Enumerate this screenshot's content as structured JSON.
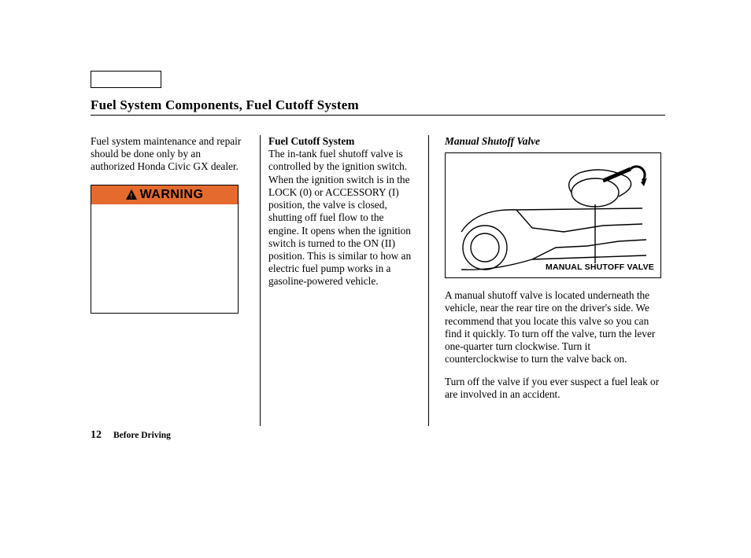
{
  "page": {
    "title": "Fuel System Components, Fuel Cutoff System",
    "number": "12",
    "section": "Before Driving"
  },
  "col1": {
    "p1": "Fuel system maintenance and repair should be done only by an authorized Honda Civic GX dealer.",
    "warning_label": "WARNING"
  },
  "col2": {
    "heading": "Fuel Cutoff System",
    "p1": "The in-tank fuel shutoff valve is controlled by the ignition switch. When the ignition switch is in the LOCK (0) or ACCESSORY (I) position, the valve is closed, shutting off fuel flow to the engine. It opens when the ignition switch is turned to the ON (II) position. This is similar to how an electric fuel pump works in a gasoline-powered vehicle."
  },
  "col3": {
    "heading": "Manual Shutoff Valve",
    "diagram_label": "MANUAL SHUTOFF VALVE",
    "p1": "A manual shutoff valve is located underneath the vehicle, near the rear tire on the driver's side. We recommend that you locate this valve so you can find it quickly. To turn off the valve, turn the lever one-quarter turn clockwise. Turn it counterclockwise to turn the valve back on.",
    "p2": "Turn off the valve if you ever suspect a fuel leak or are involved in an accident."
  }
}
